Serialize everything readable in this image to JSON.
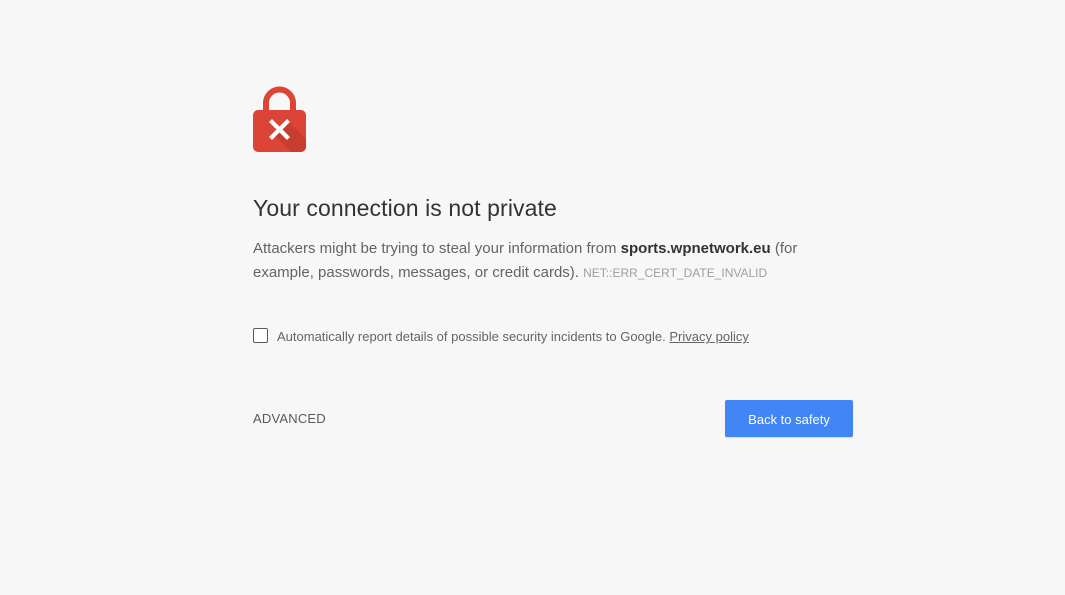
{
  "page": {
    "title": "Your connection is not private",
    "description_prefix": "Attackers might be trying to steal your information from ",
    "host": "sports.wpnetwork.eu",
    "description_suffix": " (for example, passwords, messages, or credit cards). ",
    "error_code": "NET::ERR_CERT_DATE_INVALID"
  },
  "report": {
    "label": "Automatically report details of possible security incidents to Google. ",
    "privacy_link": "Privacy policy",
    "checked": false
  },
  "buttons": {
    "advanced": "ADVANCED",
    "back_to_safety": "Back to safety"
  },
  "icons": {
    "lock": "broken-lock-icon"
  },
  "colors": {
    "lock_red": "#db4437",
    "primary_blue": "#4285f4",
    "background": "#f7f7f7"
  }
}
